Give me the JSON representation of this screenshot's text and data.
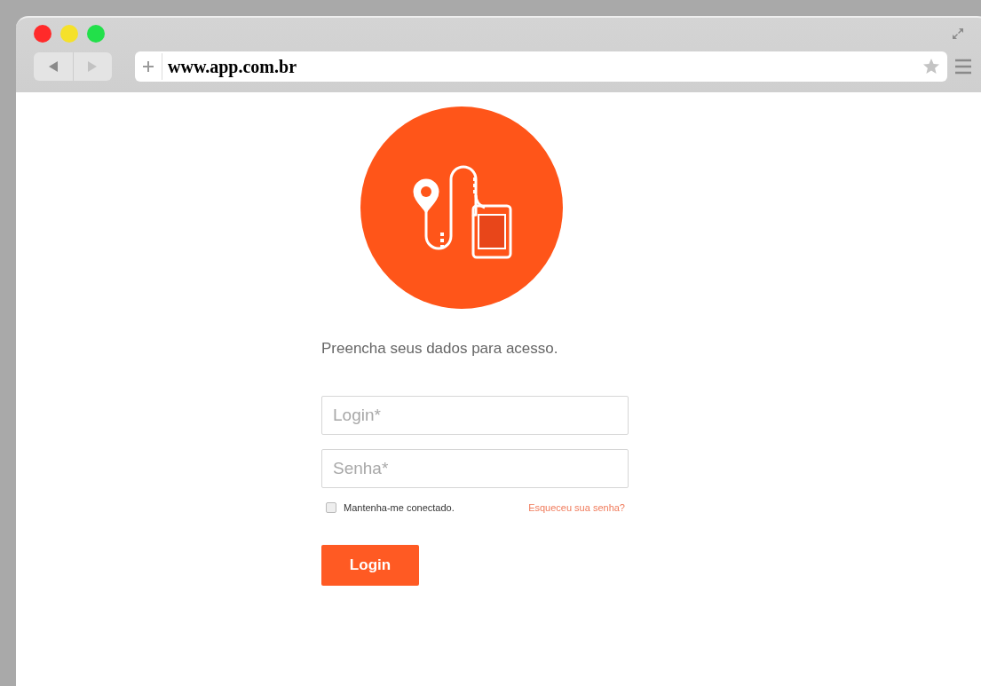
{
  "browser": {
    "url": "www.app.com.br"
  },
  "login_form": {
    "instruction": "Preencha seus dados para acesso.",
    "fields": [
      {
        "placeholder": "Login*"
      },
      {
        "placeholder": "Senha*"
      }
    ],
    "remember": {
      "label": "Mantenha-me conectado.",
      "checked": false
    },
    "forgot_link": "Esqueceu sua senha?",
    "submit_button": "Login"
  }
}
